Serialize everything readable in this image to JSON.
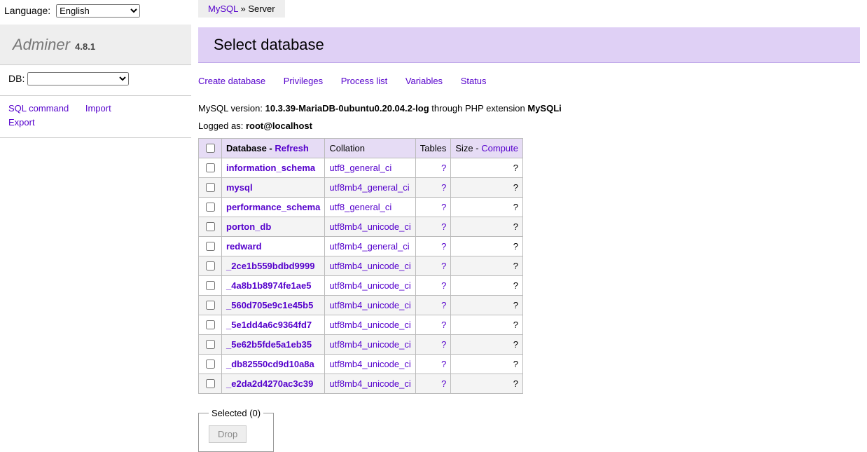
{
  "lang": {
    "label": "Language:",
    "value": "English"
  },
  "logo": {
    "name": "Adminer",
    "version": "4.8.1"
  },
  "sidebar": {
    "db_label": "DB:",
    "links": {
      "sql": "SQL command",
      "import": "Import",
      "export": "Export"
    }
  },
  "breadcrumb": {
    "root": "MySQL",
    "sep": " » ",
    "server": "Server"
  },
  "title": "Select database",
  "nav": {
    "create": "Create database",
    "privileges": "Privileges",
    "processlist": "Process list",
    "variables": "Variables",
    "status": "Status"
  },
  "version_line": {
    "prefix": "MySQL version: ",
    "version": "10.3.39-MariaDB-0ubuntu0.20.04.2-log",
    "mid": " through PHP extension ",
    "ext": "MySQLi"
  },
  "logged": {
    "prefix": "Logged as: ",
    "user": "root@localhost"
  },
  "table": {
    "head": {
      "db": "Database",
      "refresh": "Refresh",
      "collation": "Collation",
      "tables": "Tables",
      "size": "Size",
      "compute": "Compute",
      "dash": " - "
    },
    "rows": [
      {
        "name": "information_schema",
        "collation": "utf8_general_ci",
        "tables": "?",
        "size": "?"
      },
      {
        "name": "mysql",
        "collation": "utf8mb4_general_ci",
        "tables": "?",
        "size": "?"
      },
      {
        "name": "performance_schema",
        "collation": "utf8_general_ci",
        "tables": "?",
        "size": "?"
      },
      {
        "name": "porton_db",
        "collation": "utf8mb4_unicode_ci",
        "tables": "?",
        "size": "?"
      },
      {
        "name": "redward",
        "collation": "utf8mb4_general_ci",
        "tables": "?",
        "size": "?"
      },
      {
        "name": "_2ce1b559bdbd9999",
        "collation": "utf8mb4_unicode_ci",
        "tables": "?",
        "size": "?"
      },
      {
        "name": "_4a8b1b8974fe1ae5",
        "collation": "utf8mb4_unicode_ci",
        "tables": "?",
        "size": "?"
      },
      {
        "name": "_560d705e9c1e45b5",
        "collation": "utf8mb4_unicode_ci",
        "tables": "?",
        "size": "?"
      },
      {
        "name": "_5e1dd4a6c9364fd7",
        "collation": "utf8mb4_unicode_ci",
        "tables": "?",
        "size": "?"
      },
      {
        "name": "_5e62b5fde5a1eb35",
        "collation": "utf8mb4_unicode_ci",
        "tables": "?",
        "size": "?"
      },
      {
        "name": "_db82550cd9d10a8a",
        "collation": "utf8mb4_unicode_ci",
        "tables": "?",
        "size": "?"
      },
      {
        "name": "_e2da2d4270ac3c39",
        "collation": "utf8mb4_unicode_ci",
        "tables": "?",
        "size": "?"
      }
    ]
  },
  "selected": {
    "legend": "Selected (0)",
    "drop": "Drop"
  }
}
